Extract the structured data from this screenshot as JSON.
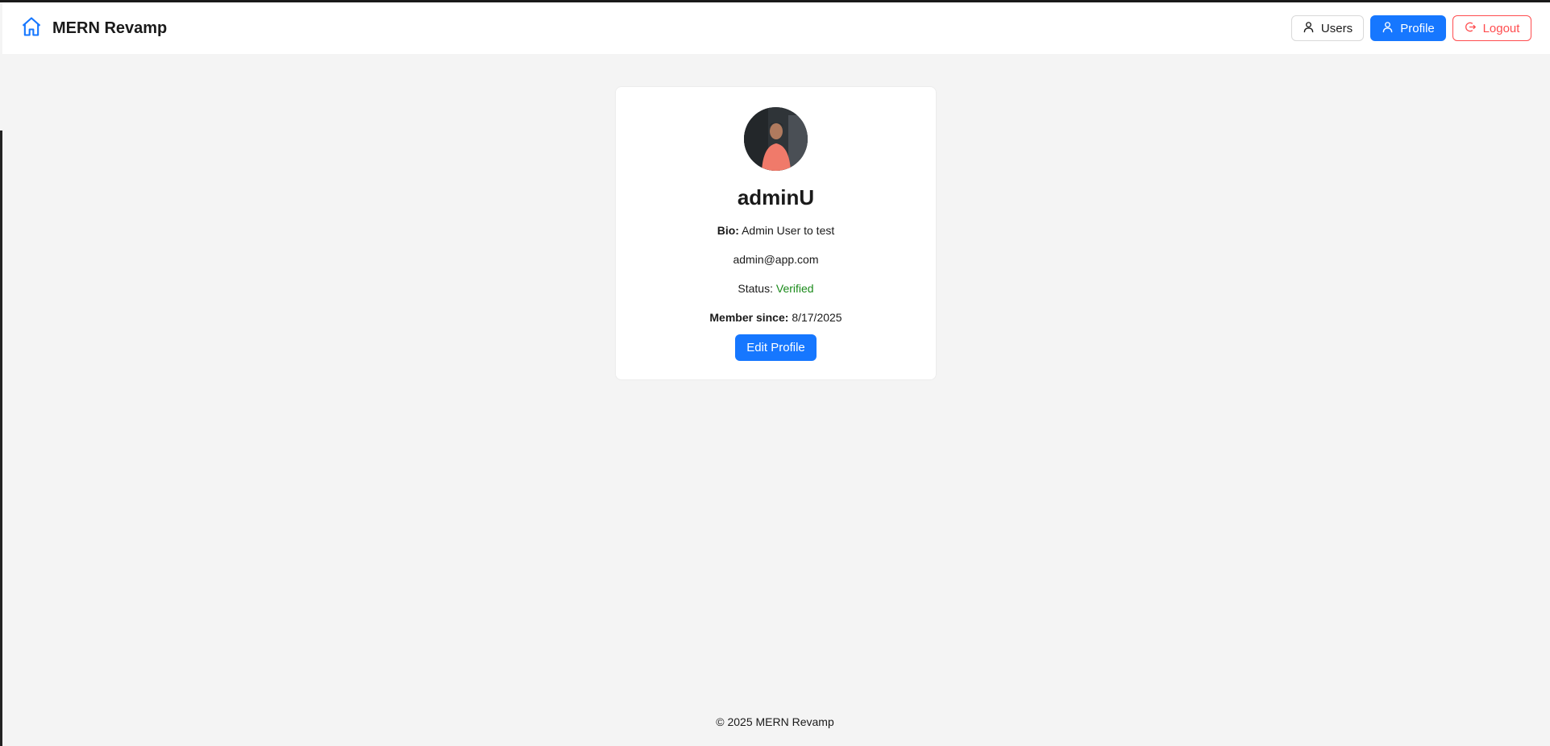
{
  "header": {
    "brand_title": "MERN Revamp",
    "brand_icon": "home-icon",
    "nav": {
      "users_label": "Users",
      "profile_label": "Profile",
      "logout_label": "Logout"
    }
  },
  "profile": {
    "username": "adminU",
    "bio_label": "Bio:",
    "bio_value": "Admin User to test",
    "email": "admin@app.com",
    "status_label": "Status:",
    "status_value": "Verified",
    "member_label": "Member since:",
    "member_value": "8/17/2025",
    "edit_button": "Edit Profile"
  },
  "footer": {
    "text": "© 2025 MERN Revamp"
  },
  "colors": {
    "primary": "#1677ff",
    "danger": "#ff4d4f",
    "verified": "#1a8a1a",
    "background": "#f4f4f4"
  }
}
